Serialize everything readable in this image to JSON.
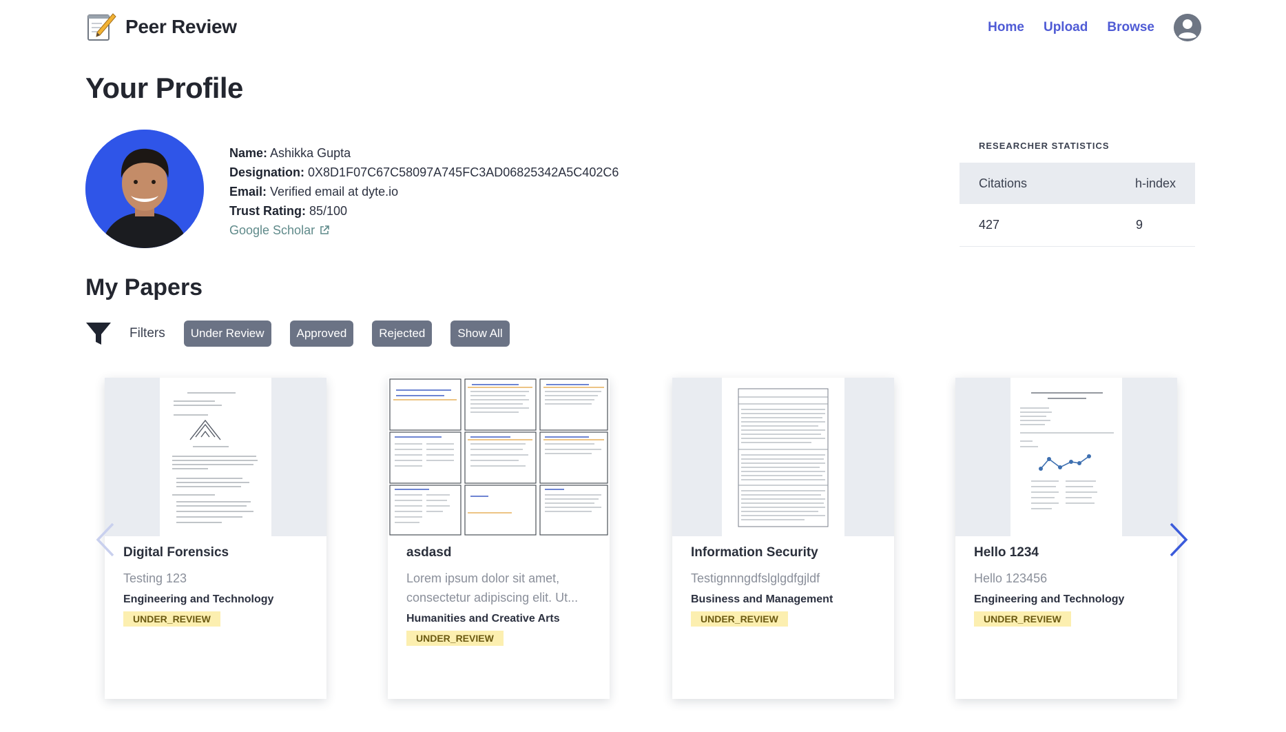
{
  "app": {
    "name": "Peer Review"
  },
  "nav": {
    "home": "Home",
    "upload": "Upload",
    "browse": "Browse"
  },
  "page_title": "Your Profile",
  "profile": {
    "name_label": "Name:",
    "name": "Ashikka Gupta",
    "designation_label": "Designation:",
    "designation": "0X8D1F07C67C58097A745FC3AD06825342A5C402C6",
    "email_label": "Email:",
    "email": "Verified email at dyte.io",
    "trust_label": "Trust Rating:",
    "trust": "85/100",
    "scholar_link": "Google Scholar"
  },
  "stats": {
    "caption": "RESEARCHER STATISTICS",
    "headers": [
      "Citations",
      "h-index"
    ],
    "values": [
      "427",
      "9"
    ]
  },
  "papers_title": "My Papers",
  "filters": {
    "label": "Filters",
    "options": [
      "Under Review",
      "Approved",
      "Rejected",
      "Show All"
    ]
  },
  "papers": [
    {
      "title": "Digital Forensics",
      "description": "Testing 123",
      "field": "Engineering and Technology",
      "status": "UNDER_REVIEW"
    },
    {
      "title": "asdasd",
      "description": "Lorem ipsum dolor sit amet, consectetur adipiscing elit. Ut...",
      "field": "Humanities and Creative Arts",
      "status": "UNDER_REVIEW"
    },
    {
      "title": "Information Security",
      "description": "Testignnngdfslglgdfgjldf",
      "field": "Business and Management",
      "status": "UNDER_REVIEW"
    },
    {
      "title": "Hello 1234",
      "description": "Hello 123456",
      "field": "Engineering and Technology",
      "status": "UNDER_REVIEW"
    }
  ],
  "colors": {
    "nav_link": "#4f5bd5",
    "chip": "#6b7385",
    "badge_bg": "#fcefb0",
    "avatar_bg": "#2f55e8",
    "carousel_arrow": "#3b5bdb"
  },
  "icons": {
    "brand": "memo-pencil-icon",
    "account": "user-circle-icon",
    "filter": "funnel-icon",
    "external_link": "external-link-icon",
    "prev": "chevron-left-icon",
    "next": "chevron-right-icon"
  }
}
